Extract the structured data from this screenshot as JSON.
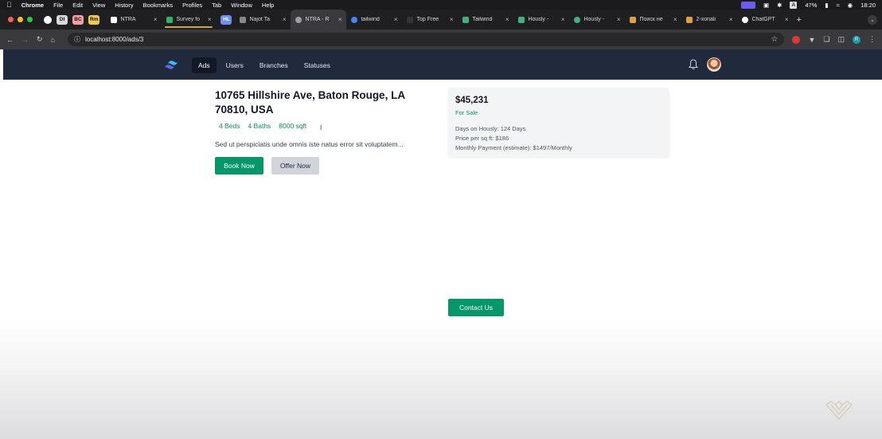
{
  "menubar": {
    "app": "Chrome",
    "items": [
      "File",
      "Edit",
      "View",
      "History",
      "Bookmarks",
      "Profiles",
      "Tab",
      "Window",
      "Help"
    ],
    "battery": "47%",
    "time": "18:20",
    "input_source": "A"
  },
  "tabs": {
    "pinned": [
      {
        "label": "DI",
        "color": "#d9d9d9"
      },
      {
        "label": "BC",
        "color": "#f2a1a1"
      },
      {
        "label": "Rm",
        "color": "#f2c94c"
      }
    ],
    "items": [
      {
        "label": "NTRA",
        "fav": "#ffffff"
      },
      {
        "label": "Survey fo",
        "fav": "#2fb36b"
      },
      {
        "label": "HL",
        "fav": "#6c8ef5"
      },
      {
        "label": "Najot Ta",
        "fav": "#888888"
      },
      {
        "label": "NTRA - R",
        "fav": "#9aa0a6"
      },
      {
        "label": "tailwind",
        "fav": "#4285f4"
      },
      {
        "label": "Top Free",
        "fav": "#333333"
      },
      {
        "label": "Tailwind",
        "fav": "#3fb27f"
      },
      {
        "label": "Hously -",
        "fav": "#3fb27f"
      },
      {
        "label": "Hously -",
        "fav": "#3fb27f"
      },
      {
        "label": "Поиск не",
        "fav": "#e0a040"
      },
      {
        "label": "2-xonali",
        "fav": "#e0a040"
      },
      {
        "label": "ChatGPT",
        "fav": "#ffffff"
      }
    ]
  },
  "address": {
    "url": "localhost:8000/ads/3"
  },
  "navbar": {
    "links": [
      "Ads",
      "Users",
      "Branches",
      "Statuses"
    ],
    "active": "Ads"
  },
  "listing": {
    "title": "10765 Hillshire Ave, Baton Rouge, LA 70810, USA",
    "beds": "4 Beds",
    "baths": "4 Baths",
    "sqft": "8000 sqft",
    "description": "Sed ut perspiciatis unde omnis iste natus error sit voluptatem...",
    "book_label": "Book Now",
    "offer_label": "Offer Now"
  },
  "card": {
    "price": "$45,231",
    "status": "For Sale",
    "days": "Days on Hously: 124 Days",
    "price_sqft": "Price per sq ft: $186",
    "monthly": "Monthly Payment (estimate): $1497/Monthly"
  },
  "contact": {
    "label": "Contact Us"
  },
  "colors": {
    "navbar_bg": "#202a3c",
    "accent_green": "#059669",
    "secondary_button": "#d1d5db"
  }
}
